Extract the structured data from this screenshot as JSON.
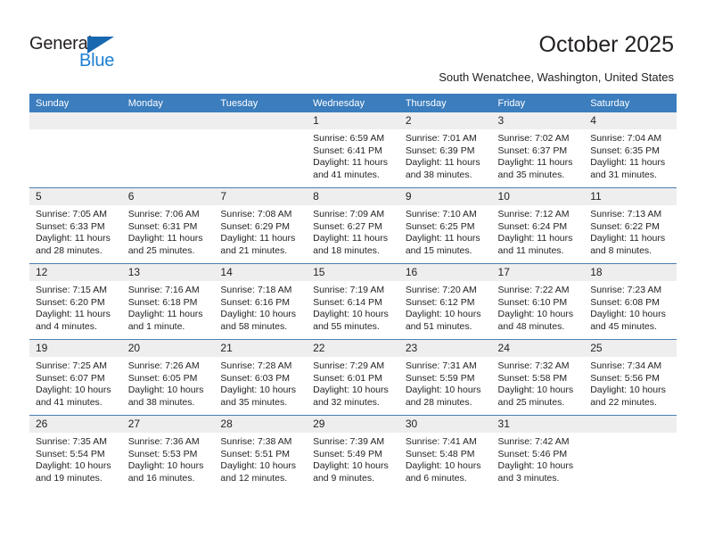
{
  "brand": {
    "name_part1": "General",
    "name_part2": "Blue",
    "accent_color": "#1b7fd4",
    "triangle_color": "#1868b0"
  },
  "header": {
    "title": "October 2025",
    "subtitle": "South Wenatchee, Washington, United States"
  },
  "calendar": {
    "header_color": "#3b7dbd",
    "weekdays": [
      "Sunday",
      "Monday",
      "Tuesday",
      "Wednesday",
      "Thursday",
      "Friday",
      "Saturday"
    ],
    "weeks": [
      [
        {
          "day": "",
          "sunrise": "",
          "sunset": "",
          "daylight_line1": "",
          "daylight_line2": ""
        },
        {
          "day": "",
          "sunrise": "",
          "sunset": "",
          "daylight_line1": "",
          "daylight_line2": ""
        },
        {
          "day": "",
          "sunrise": "",
          "sunset": "",
          "daylight_line1": "",
          "daylight_line2": ""
        },
        {
          "day": "1",
          "sunrise": "Sunrise: 6:59 AM",
          "sunset": "Sunset: 6:41 PM",
          "daylight_line1": "Daylight: 11 hours",
          "daylight_line2": "and 41 minutes."
        },
        {
          "day": "2",
          "sunrise": "Sunrise: 7:01 AM",
          "sunset": "Sunset: 6:39 PM",
          "daylight_line1": "Daylight: 11 hours",
          "daylight_line2": "and 38 minutes."
        },
        {
          "day": "3",
          "sunrise": "Sunrise: 7:02 AM",
          "sunset": "Sunset: 6:37 PM",
          "daylight_line1": "Daylight: 11 hours",
          "daylight_line2": "and 35 minutes."
        },
        {
          "day": "4",
          "sunrise": "Sunrise: 7:04 AM",
          "sunset": "Sunset: 6:35 PM",
          "daylight_line1": "Daylight: 11 hours",
          "daylight_line2": "and 31 minutes."
        }
      ],
      [
        {
          "day": "5",
          "sunrise": "Sunrise: 7:05 AM",
          "sunset": "Sunset: 6:33 PM",
          "daylight_line1": "Daylight: 11 hours",
          "daylight_line2": "and 28 minutes."
        },
        {
          "day": "6",
          "sunrise": "Sunrise: 7:06 AM",
          "sunset": "Sunset: 6:31 PM",
          "daylight_line1": "Daylight: 11 hours",
          "daylight_line2": "and 25 minutes."
        },
        {
          "day": "7",
          "sunrise": "Sunrise: 7:08 AM",
          "sunset": "Sunset: 6:29 PM",
          "daylight_line1": "Daylight: 11 hours",
          "daylight_line2": "and 21 minutes."
        },
        {
          "day": "8",
          "sunrise": "Sunrise: 7:09 AM",
          "sunset": "Sunset: 6:27 PM",
          "daylight_line1": "Daylight: 11 hours",
          "daylight_line2": "and 18 minutes."
        },
        {
          "day": "9",
          "sunrise": "Sunrise: 7:10 AM",
          "sunset": "Sunset: 6:25 PM",
          "daylight_line1": "Daylight: 11 hours",
          "daylight_line2": "and 15 minutes."
        },
        {
          "day": "10",
          "sunrise": "Sunrise: 7:12 AM",
          "sunset": "Sunset: 6:24 PM",
          "daylight_line1": "Daylight: 11 hours",
          "daylight_line2": "and 11 minutes."
        },
        {
          "day": "11",
          "sunrise": "Sunrise: 7:13 AM",
          "sunset": "Sunset: 6:22 PM",
          "daylight_line1": "Daylight: 11 hours",
          "daylight_line2": "and 8 minutes."
        }
      ],
      [
        {
          "day": "12",
          "sunrise": "Sunrise: 7:15 AM",
          "sunset": "Sunset: 6:20 PM",
          "daylight_line1": "Daylight: 11 hours",
          "daylight_line2": "and 4 minutes."
        },
        {
          "day": "13",
          "sunrise": "Sunrise: 7:16 AM",
          "sunset": "Sunset: 6:18 PM",
          "daylight_line1": "Daylight: 11 hours",
          "daylight_line2": "and 1 minute."
        },
        {
          "day": "14",
          "sunrise": "Sunrise: 7:18 AM",
          "sunset": "Sunset: 6:16 PM",
          "daylight_line1": "Daylight: 10 hours",
          "daylight_line2": "and 58 minutes."
        },
        {
          "day": "15",
          "sunrise": "Sunrise: 7:19 AM",
          "sunset": "Sunset: 6:14 PM",
          "daylight_line1": "Daylight: 10 hours",
          "daylight_line2": "and 55 minutes."
        },
        {
          "day": "16",
          "sunrise": "Sunrise: 7:20 AM",
          "sunset": "Sunset: 6:12 PM",
          "daylight_line1": "Daylight: 10 hours",
          "daylight_line2": "and 51 minutes."
        },
        {
          "day": "17",
          "sunrise": "Sunrise: 7:22 AM",
          "sunset": "Sunset: 6:10 PM",
          "daylight_line1": "Daylight: 10 hours",
          "daylight_line2": "and 48 minutes."
        },
        {
          "day": "18",
          "sunrise": "Sunrise: 7:23 AM",
          "sunset": "Sunset: 6:08 PM",
          "daylight_line1": "Daylight: 10 hours",
          "daylight_line2": "and 45 minutes."
        }
      ],
      [
        {
          "day": "19",
          "sunrise": "Sunrise: 7:25 AM",
          "sunset": "Sunset: 6:07 PM",
          "daylight_line1": "Daylight: 10 hours",
          "daylight_line2": "and 41 minutes."
        },
        {
          "day": "20",
          "sunrise": "Sunrise: 7:26 AM",
          "sunset": "Sunset: 6:05 PM",
          "daylight_line1": "Daylight: 10 hours",
          "daylight_line2": "and 38 minutes."
        },
        {
          "day": "21",
          "sunrise": "Sunrise: 7:28 AM",
          "sunset": "Sunset: 6:03 PM",
          "daylight_line1": "Daylight: 10 hours",
          "daylight_line2": "and 35 minutes."
        },
        {
          "day": "22",
          "sunrise": "Sunrise: 7:29 AM",
          "sunset": "Sunset: 6:01 PM",
          "daylight_line1": "Daylight: 10 hours",
          "daylight_line2": "and 32 minutes."
        },
        {
          "day": "23",
          "sunrise": "Sunrise: 7:31 AM",
          "sunset": "Sunset: 5:59 PM",
          "daylight_line1": "Daylight: 10 hours",
          "daylight_line2": "and 28 minutes."
        },
        {
          "day": "24",
          "sunrise": "Sunrise: 7:32 AM",
          "sunset": "Sunset: 5:58 PM",
          "daylight_line1": "Daylight: 10 hours",
          "daylight_line2": "and 25 minutes."
        },
        {
          "day": "25",
          "sunrise": "Sunrise: 7:34 AM",
          "sunset": "Sunset: 5:56 PM",
          "daylight_line1": "Daylight: 10 hours",
          "daylight_line2": "and 22 minutes."
        }
      ],
      [
        {
          "day": "26",
          "sunrise": "Sunrise: 7:35 AM",
          "sunset": "Sunset: 5:54 PM",
          "daylight_line1": "Daylight: 10 hours",
          "daylight_line2": "and 19 minutes."
        },
        {
          "day": "27",
          "sunrise": "Sunrise: 7:36 AM",
          "sunset": "Sunset: 5:53 PM",
          "daylight_line1": "Daylight: 10 hours",
          "daylight_line2": "and 16 minutes."
        },
        {
          "day": "28",
          "sunrise": "Sunrise: 7:38 AM",
          "sunset": "Sunset: 5:51 PM",
          "daylight_line1": "Daylight: 10 hours",
          "daylight_line2": "and 12 minutes."
        },
        {
          "day": "29",
          "sunrise": "Sunrise: 7:39 AM",
          "sunset": "Sunset: 5:49 PM",
          "daylight_line1": "Daylight: 10 hours",
          "daylight_line2": "and 9 minutes."
        },
        {
          "day": "30",
          "sunrise": "Sunrise: 7:41 AM",
          "sunset": "Sunset: 5:48 PM",
          "daylight_line1": "Daylight: 10 hours",
          "daylight_line2": "and 6 minutes."
        },
        {
          "day": "31",
          "sunrise": "Sunrise: 7:42 AM",
          "sunset": "Sunset: 5:46 PM",
          "daylight_line1": "Daylight: 10 hours",
          "daylight_line2": "and 3 minutes."
        },
        {
          "day": "",
          "sunrise": "",
          "sunset": "",
          "daylight_line1": "",
          "daylight_line2": ""
        }
      ]
    ]
  }
}
